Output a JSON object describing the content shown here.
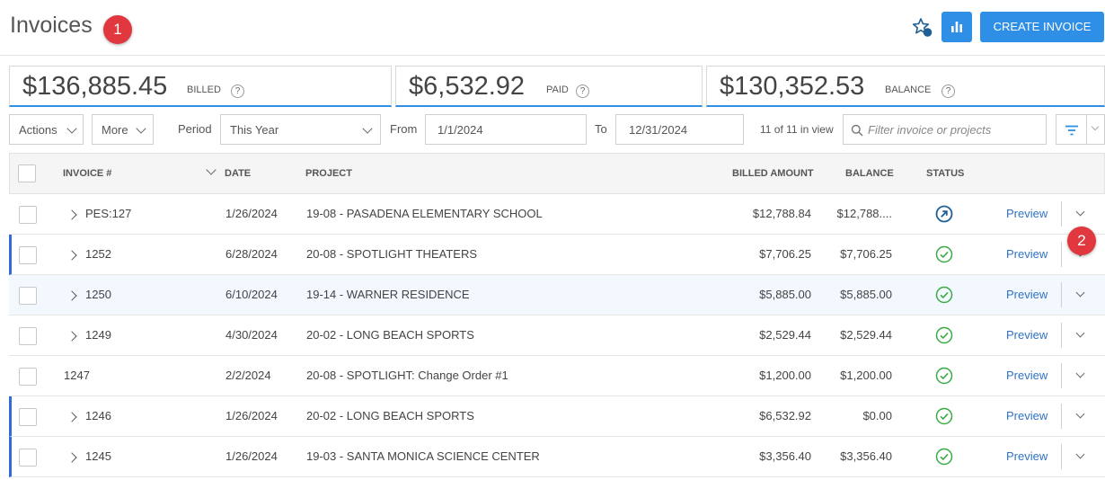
{
  "header": {
    "title": "Invoices",
    "create_label": "CREATE INVOICE",
    "badges": [
      "1",
      "2"
    ]
  },
  "summary": {
    "billed": {
      "amount": "$136,885.45",
      "label": "BILLED",
      "help": "?"
    },
    "paid": {
      "amount": "$6,532.92",
      "label": "PAID",
      "help": "?"
    },
    "balance": {
      "amount": "$130,352.53",
      "label": "BALANCE",
      "help": "?"
    }
  },
  "toolbar": {
    "actions_label": "Actions",
    "more_label": "More",
    "period_label": "Period",
    "period_value": "This Year",
    "from_label": "From",
    "from_value": "1/1/2024",
    "to_label": "To",
    "to_value": "12/31/2024",
    "count_text": "11 of 11 in view",
    "search_placeholder": "Filter invoice or projects"
  },
  "table": {
    "columns": [
      "INVOICE #",
      "DATE",
      "PROJECT",
      "BILLED AMOUNT",
      "BALANCE",
      "STATUS"
    ],
    "preview_label": "Preview",
    "rows": [
      {
        "invoice": "PES:127",
        "date": "1/26/2024",
        "project": "19-08 - PASADENA ELEMENTARY SCHOOL",
        "billed": "$12,788.84",
        "balance": "$12,788....",
        "status": "sent"
      },
      {
        "invoice": "1252",
        "date": "6/28/2024",
        "project": "20-08 - SPOTLIGHT THEATERS",
        "billed": "$7,706.25",
        "balance": "$7,706.25",
        "status": "approved"
      },
      {
        "invoice": "1250",
        "date": "6/10/2024",
        "project": "19-14 - WARNER RESIDENCE",
        "billed": "$5,885.00",
        "balance": "$5,885.00",
        "status": "approved"
      },
      {
        "invoice": "1249",
        "date": "4/30/2024",
        "project": "20-02 - LONG BEACH SPORTS",
        "billed": "$2,529.44",
        "balance": "$2,529.44",
        "status": "approved"
      },
      {
        "invoice": "1247",
        "date": "2/2/2024",
        "project": "20-08 - SPOTLIGHT: Change Order #1",
        "billed": "$1,200.00",
        "balance": "$1,200.00",
        "status": "approved"
      },
      {
        "invoice": "1246",
        "date": "1/26/2024",
        "project": "20-02 - LONG BEACH SPORTS",
        "billed": "$6,532.92",
        "balance": "$0.00",
        "status": "approved"
      },
      {
        "invoice": "1245",
        "date": "1/26/2024",
        "project": "19-03 - SANTA MONICA SCIENCE CENTER",
        "billed": "$3,356.40",
        "balance": "$3,356.40",
        "status": "approved"
      }
    ]
  },
  "colors": {
    "accent": "#2f8fe6",
    "link": "#2f72c4",
    "approved": "#3aaa45",
    "sent": "#1f5f95",
    "badge": "#e0383e"
  },
  "icons": [
    "star-badge-icon",
    "bar-chart-icon",
    "help-icon",
    "chevron-down-icon",
    "search-icon",
    "filter-icon",
    "expand-chevron-icon",
    "check-circle-icon",
    "arrow-up-right-circle-icon"
  ]
}
